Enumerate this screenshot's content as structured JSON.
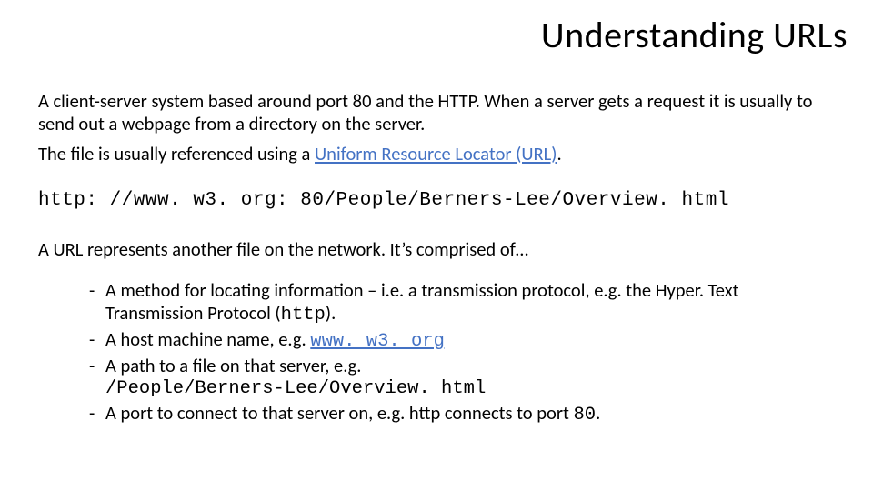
{
  "title": "Understanding URLs",
  "para1": "A client-server system based around port 80 and the HTTP. When a server gets a request it is usually to send out a webpage from a directory on the server.",
  "para2": {
    "before": "The file is usually referenced using a ",
    "link": "Uniform Resource Locator (URL)",
    "after": "."
  },
  "example_url": "http: //www. w3. org: 80/People/Berners-Lee/Overview. html",
  "para3": "A URL represents another file on the network. It’s comprised of…",
  "bullets": [
    {
      "parts": [
        "A method for locating information – i.e. a transmission protocol, e.g. the Hyper. Text Transmission Protocol (",
        "http",
        ")."
      ]
    },
    {
      "parts": [
        "A host machine name, e.g. ",
        "www. w3. org"
      ]
    },
    {
      "parts": [
        "A path to a file on that server, e.g.",
        "/People/Berners-Lee/Overview. html"
      ]
    },
    {
      "parts": [
        "A port to connect to that server on, e.g. http connects to port ",
        "80",
        "."
      ]
    }
  ]
}
